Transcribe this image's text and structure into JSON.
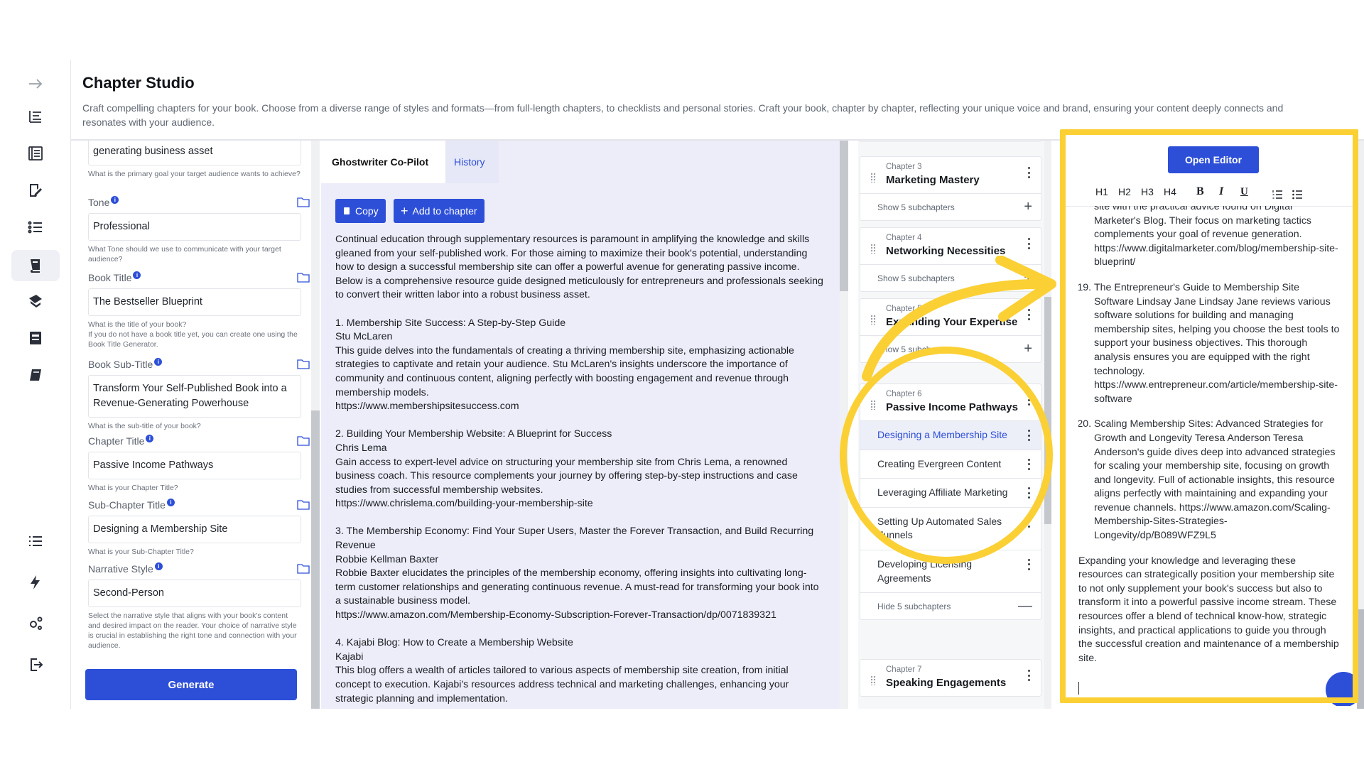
{
  "header": {
    "title": "Chapter Studio",
    "description": "Craft compelling chapters for your book. Choose from a diverse range of styles and formats—from full-length chapters, to checklists and personal stories. Craft your book, chapter by chapter, reflecting your unique voice and brand, ensuring your content deeply connects and resonates with your audience."
  },
  "sidebar": {
    "icons": [
      "arrow-right-icon",
      "outline-list-icon",
      "book-list-icon",
      "edit-document-icon",
      "numbered-list-icon",
      "book-stack-icon",
      "stamp-book-icon",
      "archive-book-icon",
      "notebook-icon",
      "menu-list-icon",
      "lightning-icon",
      "gears-icon",
      "logout-icon"
    ]
  },
  "form": {
    "goal": {
      "value": "generating business asset",
      "help": "What is the primary goal your target audience wants to achieve?"
    },
    "tone": {
      "label": "Tone",
      "value": "Professional",
      "help": "What Tone should we use to communicate with your target audience?"
    },
    "book_title": {
      "label": "Book Title",
      "value": "The Bestseller Blueprint",
      "help": "What is the title of your book?",
      "help2": "If you do not have a book title yet, you can create one using the Book Title Generator."
    },
    "book_subtitle": {
      "label": "Book Sub-Title",
      "value": "Transform Your Self-Published Book into a Revenue-Generating Powerhouse",
      "help": "What is the sub-title of your book?"
    },
    "chapter_title": {
      "label": "Chapter Title",
      "value": "Passive Income Pathways",
      "help": "What is your Chapter Title?"
    },
    "subchapter_title": {
      "label": "Sub-Chapter Title",
      "value": "Designing a Membership Site",
      "help": "What is your Sub-Chapter Title?"
    },
    "narrative": {
      "label": "Narrative Style",
      "value": "Second-Person",
      "help": "Select the narrative style that aligns with your book's content and desired impact on the reader. Your choice of narrative style is crucial in establishing the right tone and connection with your audience."
    },
    "info": "i",
    "generate_label": "Generate"
  },
  "ghostwriter": {
    "tab_active": "Ghostwriter Co-Pilot",
    "tab_history": "History",
    "copy_label": "Copy",
    "add_label": "Add to chapter",
    "paragraphs": [
      "Continual education through supplementary resources is paramount in amplifying the knowledge and skills gleaned from your self-published work. For those aiming to maximize their book's potential, understanding how to design a successful membership site can offer a powerful avenue for generating passive income. Below is a comprehensive resource guide designed meticulously for entrepreneurs and professionals seeking to convert their written labor into a robust business asset.",
      "1. Membership Site Success: A Step-by-Step Guide\nStu McLaren\nThis guide delves into the fundamentals of creating a thriving membership site, emphasizing actionable strategies to captivate and retain your audience. Stu McLaren's insights underscore the importance of community and continuous content, aligning perfectly with boosting engagement and revenue through membership models.\nhttps://www.membershipsitesuccess.com",
      "2. Building Your Membership Website: A Blueprint for Success\nChris Lema\nGain access to expert-level advice on structuring your membership site from Chris Lema, a renowned business coach. This resource complements your journey by offering step-by-step instructions and case studies from successful membership websites.\nhttps://www.chrislema.com/building-your-membership-site",
      "3. The Membership Economy: Find Your Super Users, Master the Forever Transaction, and Build Recurring Revenue\nRobbie Kellman Baxter\nRobbie Baxter elucidates the principles of the membership economy, offering insights into cultivating long-term customer relationships and generating continuous revenue. A must-read for transforming your book into a sustainable business model.\nhttps://www.amazon.com/Membership-Economy-Subscription-Forever-Transaction/dp/0071839321",
      "4. Kajabi Blog: How to Create a Membership Website\nKajabi\nThis blog offers a wealth of articles tailored to various aspects of membership site creation, from initial concept to execution. Kajabi's resources address technical and marketing challenges, enhancing your strategic planning and implementation."
    ]
  },
  "chapters": {
    "cards": [
      {
        "num": "Chapter 3",
        "title": "Marketing Mastery",
        "foot": "Show 5 subchapters",
        "sign": "+"
      },
      {
        "num": "Chapter 4",
        "title": "Networking Necessities",
        "foot": "Show 5 subchapters",
        "sign": "+"
      },
      {
        "num": "Chapter 5",
        "title": "Expanding Your Expertise",
        "foot": "Show 5 subchapters",
        "sign": "+"
      },
      {
        "num": "Chapter 6",
        "title": "Passive Income Pathways",
        "foot": "Hide 5 subchapters",
        "sign": "—"
      },
      {
        "num": "Chapter 7",
        "title": "Speaking Engagements"
      }
    ],
    "subchapters": [
      "Designing a Membership Site",
      "Creating Evergreen Content",
      "Leveraging Affiliate Marketing",
      "Setting Up Automated Sales Funnels",
      "Developing Licensing Agreements"
    ]
  },
  "editor": {
    "open_label": "Open Editor",
    "toolbar": {
      "h1": "H1",
      "h2": "H2",
      "h3": "H3",
      "h4": "H4",
      "bold": "B",
      "italic": "I",
      "underline": "U"
    },
    "lead_fragment": "site with the practical advice found on Digital Marketer's Blog. Their focus on marketing tactics complements your goal of revenue generation. https://www.digitalmarketer.com/blog/membership-site-blueprint/",
    "items": [
      "The Entrepreneur's Guide to Membership Site Software Lindsay Jane Lindsay Jane reviews various software solutions for building and managing membership sites, helping you choose the best tools to support your business objectives. This thorough analysis ensures you are equipped with the right technology. https://www.entrepreneur.com/article/membership-site-software",
      "Scaling Membership Sites: Advanced Strategies for Growth and Longevity Teresa Anderson Teresa Anderson's guide dives deep into advanced strategies for scaling your membership site, focusing on growth and longevity. Full of actionable insights, this resource aligns perfectly with maintaining and expanding your revenue channels. https://www.amazon.com/Scaling-Membership-Sites-Strategies-Longevity/dp/B089WFZ9L5"
    ],
    "closing": "Expanding your knowledge and leveraging these resources can strategically position your membership site to not only supplement your book's success but also to transform it into a powerful passive income stream. These resources offer a blend of technical know-how, strategic insights, and practical applications to guide you through the successful creation and maintenance of a membership site."
  },
  "colors": {
    "accent": "#2d4fd8",
    "highlight": "#fbd034"
  }
}
